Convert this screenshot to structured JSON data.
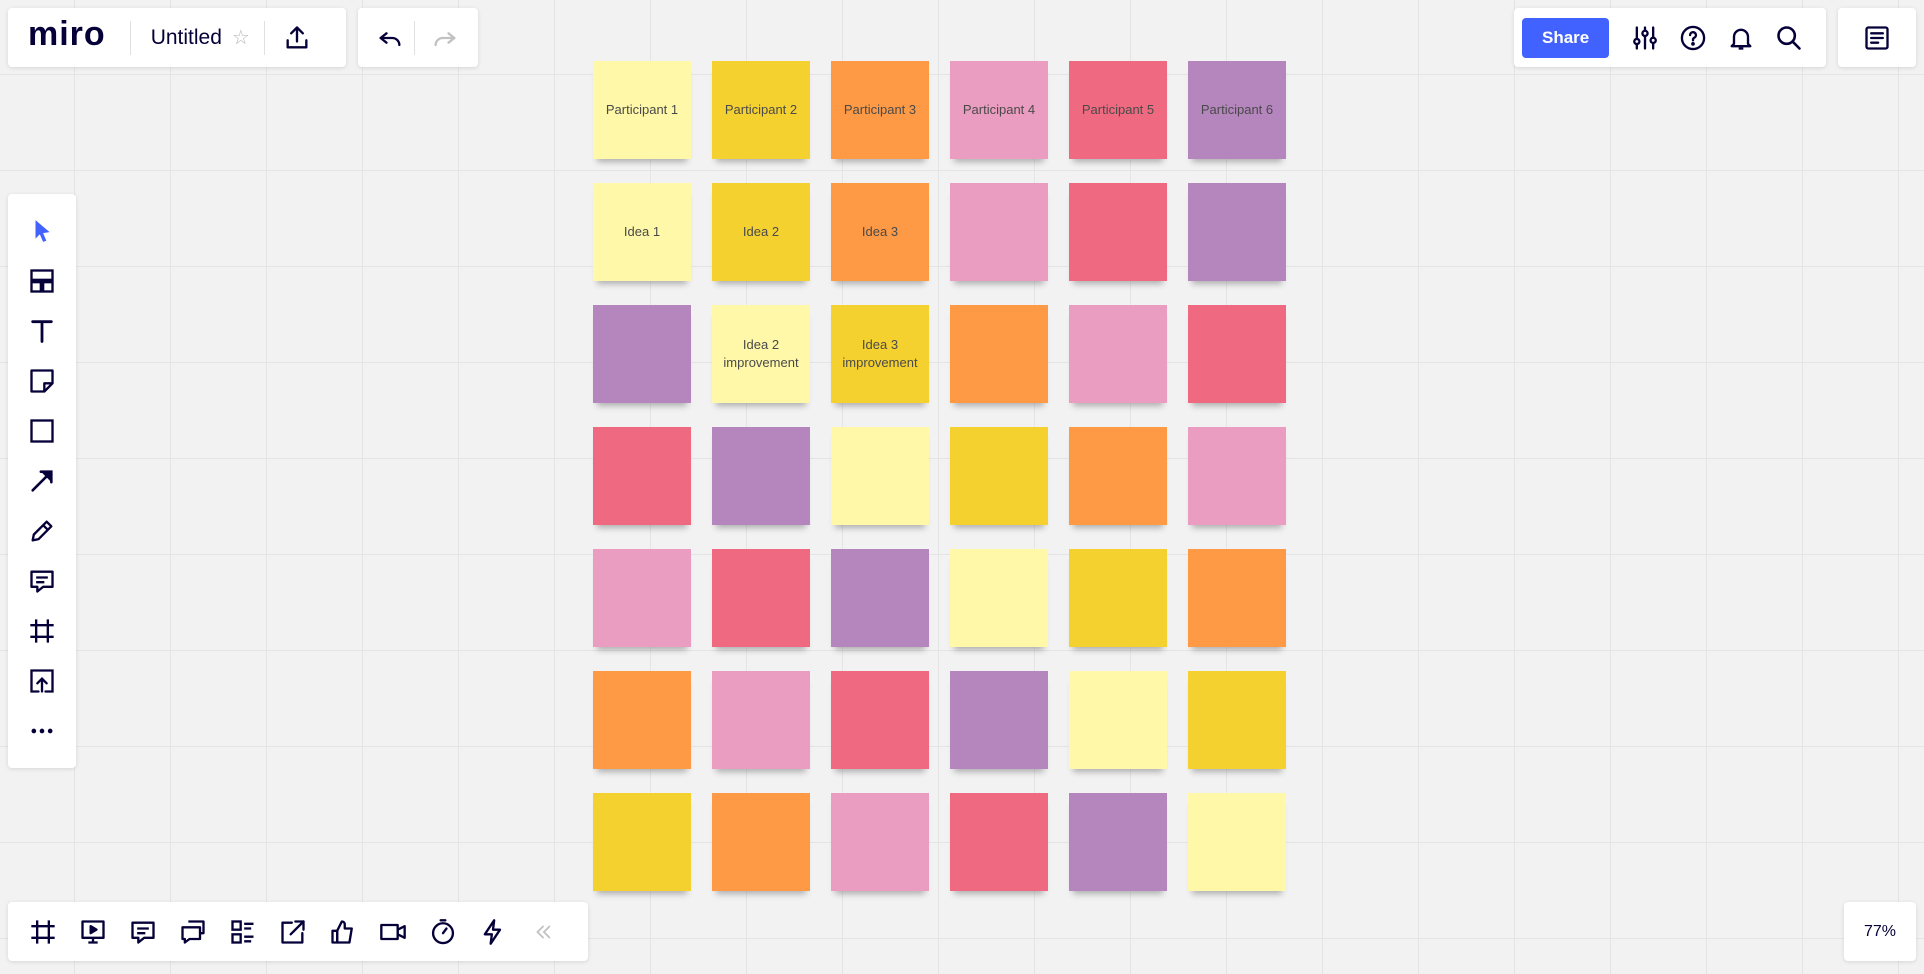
{
  "app": {
    "logo": "miro",
    "board_title": "Untitled",
    "star_icon": "☆"
  },
  "header": {
    "share_label": "Share"
  },
  "zoom": {
    "level": "77%"
  },
  "colors": {
    "accent": "#4262ff",
    "note_light_yellow": "#fef8a8",
    "note_yellow": "#f5d12f",
    "note_orange": "#fe9a46",
    "note_pink": "#eb9cc1",
    "note_red": "#ef6a80",
    "note_violet": "#b585bd"
  },
  "left_toolbar": {
    "items": [
      "select-icon",
      "templates-icon",
      "text-icon",
      "sticky-note-icon",
      "shape-icon",
      "arrow-line-icon",
      "pen-icon",
      "comment-icon",
      "frame-icon",
      "upload-icon",
      "more-icon"
    ]
  },
  "bottom_toolbar": {
    "items": [
      "frames-icon",
      "presentation-icon",
      "chat-icon",
      "cards-icon",
      "kanban-icon",
      "share-screen-icon",
      "voting-icon",
      "video-call-icon",
      "timer-icon",
      "lightning-icon",
      "collapse-icon"
    ]
  },
  "notes": [
    [
      {
        "color": "note_light_yellow",
        "text": "Participant 1"
      },
      {
        "color": "note_yellow",
        "text": "Participant 2"
      },
      {
        "color": "note_orange",
        "text": "Participant 3"
      },
      {
        "color": "note_pink",
        "text": "Participant 4"
      },
      {
        "color": "note_red",
        "text": "Participant 5"
      },
      {
        "color": "note_violet",
        "text": "Participant 6"
      }
    ],
    [
      {
        "color": "note_light_yellow",
        "text": "Idea 1"
      },
      {
        "color": "note_yellow",
        "text": "Idea 2"
      },
      {
        "color": "note_orange",
        "text": "Idea 3"
      },
      {
        "color": "note_pink",
        "text": ""
      },
      {
        "color": "note_red",
        "text": ""
      },
      {
        "color": "note_violet",
        "text": ""
      }
    ],
    [
      {
        "color": "note_violet",
        "text": ""
      },
      {
        "color": "note_light_yellow",
        "text": "Idea 2 improvement"
      },
      {
        "color": "note_yellow",
        "text": "Idea 3 improvement"
      },
      {
        "color": "note_orange",
        "text": ""
      },
      {
        "color": "note_pink",
        "text": ""
      },
      {
        "color": "note_red",
        "text": ""
      }
    ],
    [
      {
        "color": "note_red",
        "text": ""
      },
      {
        "color": "note_violet",
        "text": ""
      },
      {
        "color": "note_light_yellow",
        "text": ""
      },
      {
        "color": "note_yellow",
        "text": ""
      },
      {
        "color": "note_orange",
        "text": ""
      },
      {
        "color": "note_pink",
        "text": ""
      }
    ],
    [
      {
        "color": "note_pink",
        "text": ""
      },
      {
        "color": "note_red",
        "text": ""
      },
      {
        "color": "note_violet",
        "text": ""
      },
      {
        "color": "note_light_yellow",
        "text": ""
      },
      {
        "color": "note_yellow",
        "text": ""
      },
      {
        "color": "note_orange",
        "text": ""
      }
    ],
    [
      {
        "color": "note_orange",
        "text": ""
      },
      {
        "color": "note_pink",
        "text": ""
      },
      {
        "color": "note_red",
        "text": ""
      },
      {
        "color": "note_violet",
        "text": ""
      },
      {
        "color": "note_light_yellow",
        "text": ""
      },
      {
        "color": "note_yellow",
        "text": ""
      }
    ],
    [
      {
        "color": "note_yellow",
        "text": ""
      },
      {
        "color": "note_orange",
        "text": ""
      },
      {
        "color": "note_pink",
        "text": ""
      },
      {
        "color": "note_red",
        "text": ""
      },
      {
        "color": "note_violet",
        "text": ""
      },
      {
        "color": "note_light_yellow",
        "text": ""
      }
    ]
  ]
}
